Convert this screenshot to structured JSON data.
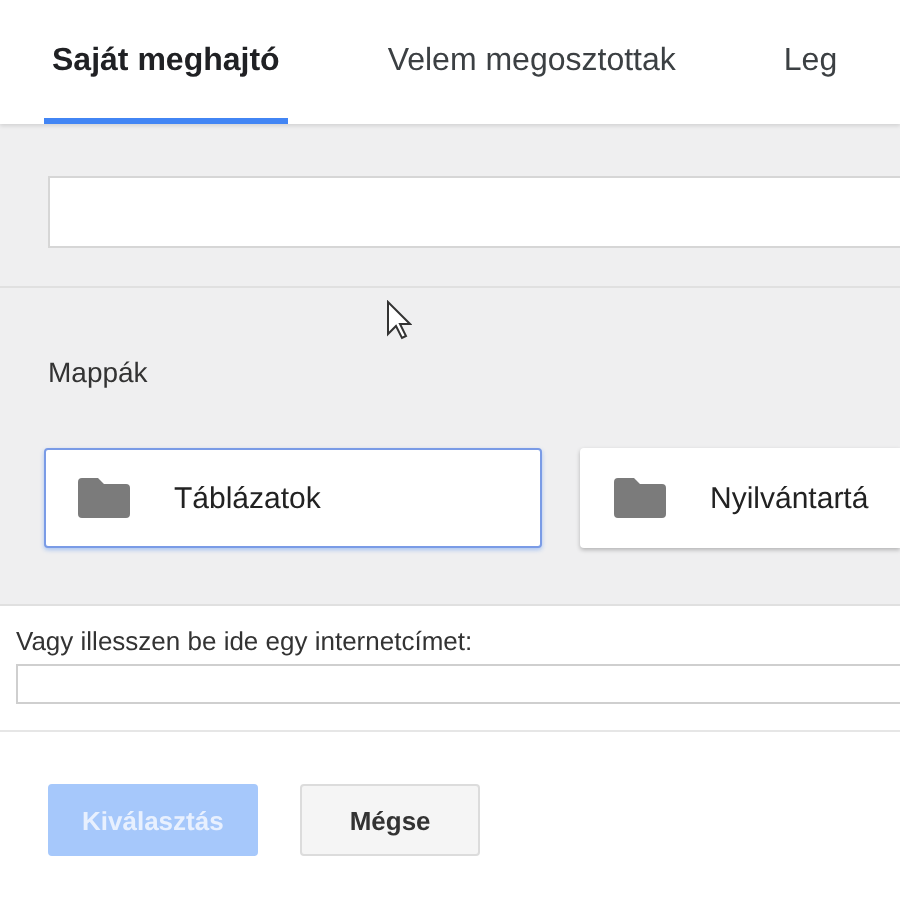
{
  "tabs": [
    {
      "label": "Saját meghajtó",
      "selected": true
    },
    {
      "label": "Velem megosztottak",
      "selected": false
    },
    {
      "label": "Leg",
      "selected": false
    }
  ],
  "folders": {
    "heading": "Mappák",
    "items": [
      {
        "name": "Táblázatok",
        "selected": true
      },
      {
        "name": "Nyilvántartá",
        "selected": false
      }
    ]
  },
  "url": {
    "label": "Vagy illesszen be ide egy internetcímet:"
  },
  "buttons": [
    {
      "label": "Kiválasztás",
      "disabled": true
    },
    {
      "label": "Mégse",
      "disabled": false
    }
  ]
}
